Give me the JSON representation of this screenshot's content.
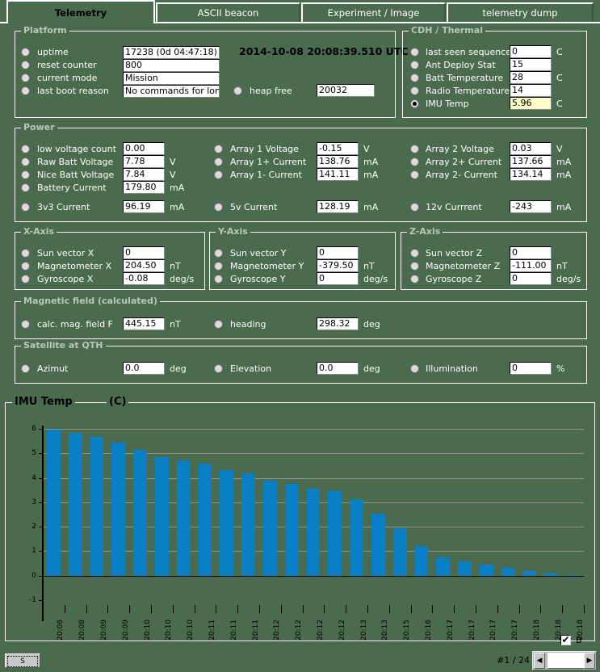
{
  "tabs": [
    {
      "label": "Telemetry",
      "active": true
    },
    {
      "label": "ASCII beacon",
      "active": false
    },
    {
      "label": "Experiment / Image",
      "active": false
    },
    {
      "label": "telemetry dump",
      "active": false
    }
  ],
  "platform": {
    "title": "Platform",
    "timestamp": "2014-10-08 20:08:39.510 UTC",
    "rows": [
      {
        "label": "uptime",
        "value": "17238  (0d 04:47:18)",
        "unit": "",
        "selected": false
      },
      {
        "label": "reset counter",
        "value": "800",
        "unit": "",
        "selected": false
      },
      {
        "label": "current mode",
        "value": "Mission",
        "unit": "",
        "selected": false
      },
      {
        "label": "last boot reason",
        "value": "No commands for long ti",
        "unit": "",
        "selected": false
      }
    ],
    "heap": {
      "label": "heap free",
      "value": "20032",
      "unit": "",
      "selected": false
    }
  },
  "cdh": {
    "title": "CDH / Thermal",
    "rows": [
      {
        "label": "last seen sequence",
        "value": "0",
        "unit": "C",
        "selected": false,
        "highlight": false
      },
      {
        "label": "Ant Deploy Stat",
        "value": "15",
        "unit": "",
        "selected": false,
        "highlight": false
      },
      {
        "label": "Batt Temperature",
        "value": "28",
        "unit": "C",
        "selected": false,
        "highlight": false
      },
      {
        "label": "Radio Temperature",
        "value": "14",
        "unit": "",
        "selected": false,
        "highlight": false
      },
      {
        "label": "IMU Temp",
        "value": "5.96",
        "unit": "C",
        "selected": true,
        "highlight": true
      }
    ]
  },
  "power": {
    "title": "Power",
    "col1": [
      {
        "label": "low voltage count",
        "value": "0.00",
        "unit": "",
        "selected": false
      },
      {
        "label": "Raw Batt Voltage",
        "value": "7.78",
        "unit": "V",
        "selected": false
      },
      {
        "label": "Nice Batt Voltage",
        "value": "7.84",
        "unit": "V",
        "selected": false
      },
      {
        "label": "Battery Current",
        "value": "179.80",
        "unit": "mA",
        "selected": false
      }
    ],
    "col2": [
      {
        "label": "Array 1 Voltage",
        "value": "-0.15",
        "unit": "V",
        "selected": false
      },
      {
        "label": "Array 1+ Current",
        "value": "138.76",
        "unit": "mA",
        "selected": false
      },
      {
        "label": "Array 1- Current",
        "value": "141.11",
        "unit": "mA",
        "selected": false
      }
    ],
    "col3": [
      {
        "label": "Array 2 Voltage",
        "value": "0.03",
        "unit": "V",
        "selected": false
      },
      {
        "label": "Array 2+ Current",
        "value": "137.66",
        "unit": "mA",
        "selected": false
      },
      {
        "label": "Array 2- Current",
        "value": "134.14",
        "unit": "mA",
        "selected": false
      }
    ],
    "bottom": [
      {
        "label": "3v3 Current",
        "value": "96.19",
        "unit": "mA",
        "selected": false
      },
      {
        "label": "5v Current",
        "value": "128.19",
        "unit": "mA",
        "selected": false
      },
      {
        "label": "12v Currrent",
        "value": "-243",
        "unit": "mA",
        "selected": false
      }
    ]
  },
  "xaxis": {
    "title": "X-Axis",
    "rows": [
      {
        "label": "Sun vector X",
        "value": "0",
        "unit": "",
        "selected": false
      },
      {
        "label": "Magnetometer X",
        "value": "204.50",
        "unit": "nT",
        "selected": false
      },
      {
        "label": "Gyroscope X",
        "value": "-0.08",
        "unit": "deg/s",
        "selected": false
      }
    ]
  },
  "yaxis": {
    "title": "Y-Axis",
    "rows": [
      {
        "label": "Sun vector Y",
        "value": "0",
        "unit": "",
        "selected": false
      },
      {
        "label": "Magnetometer Y",
        "value": "-379.50",
        "unit": "nT",
        "selected": false
      },
      {
        "label": "Gyroscope Y",
        "value": "0",
        "unit": "deg/s",
        "selected": false
      }
    ]
  },
  "zaxis": {
    "title": "Z-Axis",
    "rows": [
      {
        "label": "Sun vector Z",
        "value": "0",
        "unit": "",
        "selected": false
      },
      {
        "label": "Magnetometer Z",
        "value": "-111.00",
        "unit": "nT",
        "selected": false
      },
      {
        "label": "Gyroscope Z",
        "value": "0",
        "unit": "deg/s",
        "selected": false
      }
    ]
  },
  "magfield": {
    "title": "Magnetic field (calculated)",
    "rows": [
      {
        "label": "calc. mag. field F",
        "value": "445.15",
        "unit": "nT",
        "selected": false
      },
      {
        "label": "heading",
        "value": "298.32",
        "unit": "deg",
        "selected": false
      }
    ]
  },
  "qth": {
    "title": "Satellite at QTH",
    "rows": [
      {
        "label": "Azimut",
        "value": "0.0",
        "unit": "deg",
        "selected": false
      },
      {
        "label": "Elevation",
        "value": "0.0",
        "unit": "deg",
        "selected": false
      },
      {
        "label": "Illumination",
        "value": "0",
        "unit": "%",
        "selected": false
      }
    ]
  },
  "footer": {
    "b_checkbox": {
      "label": "B",
      "checked": true,
      "glyph": "✔"
    },
    "save_button_label": "S",
    "page_indicator": "#1 / 24",
    "scroll_left_glyph": "◀",
    "scroll_right_glyph": "▶"
  },
  "chart_data": {
    "type": "bar",
    "title": "IMU Temp",
    "unit_label": "(C)",
    "xlabel": "",
    "ylabel": "",
    "ylim": [
      -1,
      6
    ],
    "yticks": [
      6,
      5,
      4,
      3,
      2,
      1,
      0,
      -1
    ],
    "grid": true,
    "bar_color": "#0b7fc4",
    "plot_background": "#4a6b4d",
    "categories": [
      "20:06",
      "20:08",
      "20:09",
      "20:09",
      "20:10",
      "20:10",
      "20:10",
      "20:11",
      "20:11",
      "20:11",
      "20:12",
      "20:12",
      "20:12",
      "20:12",
      "20:13",
      "20:13",
      "20:15",
      "20:16",
      "20:17",
      "20:17",
      "20:17",
      "20:17",
      "20:18",
      "20:18",
      "20:18"
    ],
    "values": [
      5.97,
      5.83,
      5.68,
      5.45,
      5.15,
      4.85,
      4.7,
      4.58,
      4.32,
      4.18,
      3.88,
      3.75,
      3.55,
      3.45,
      3.12,
      2.52,
      1.95,
      1.22,
      0.75,
      0.58,
      0.44,
      0.33,
      0.2,
      0.08,
      0.02
    ]
  }
}
